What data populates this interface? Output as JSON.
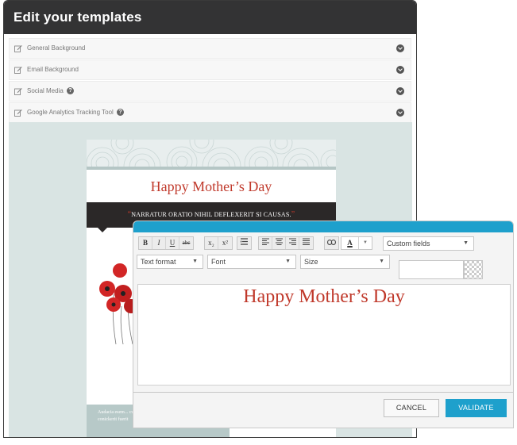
{
  "panel": {
    "title": "Edit your templates",
    "sections": [
      {
        "label": "General Background",
        "help": false
      },
      {
        "label": "Email Background",
        "help": false
      },
      {
        "label": "Social Media",
        "help": true
      },
      {
        "label": "Google Analytics Tracking Tool",
        "help": true
      }
    ]
  },
  "email_preview": {
    "title": "Happy Mother’s Day",
    "quote": "NARRATUR ORATIO NIHIL DEFLEXERIT SI CAUSAS.",
    "quote_open": "“",
    "quote_close": "”",
    "footer_text": "Audacia esem... cuius ene Alb... nec conatlater audacia fuerit hoc conickerit fuerit"
  },
  "editor": {
    "toolbar": {
      "format_buttons": [
        "B",
        "I",
        "U",
        "abc"
      ],
      "script_buttons": [
        "x₂",
        "x²"
      ],
      "color_label": "A",
      "color_arrow": "▼",
      "custom_fields": "Custom fields",
      "text_format": "Text format",
      "font": "Font",
      "size": "Size",
      "dropdown_arrow": "▼"
    },
    "content_title": "Happy Mother’s Day",
    "cancel_label": "CANCEL",
    "validate_label": "VALIDATE"
  },
  "colors": {
    "header_bg": "#333334",
    "accent": "#1ea0cc",
    "title_red": "#c0392b"
  }
}
